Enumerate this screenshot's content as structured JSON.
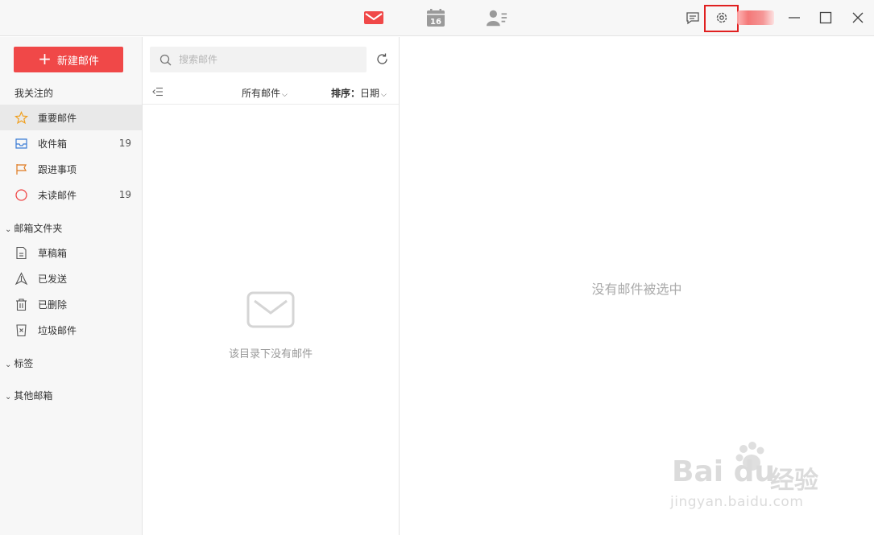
{
  "titlebar": {
    "tabs": [
      {
        "name": "mail",
        "icon": "mail-icon",
        "active": true
      },
      {
        "name": "calendar",
        "icon": "calendar-icon",
        "day": "16"
      },
      {
        "name": "contacts",
        "icon": "contacts-icon"
      }
    ],
    "actions": [
      "message-icon",
      "gear-icon"
    ],
    "window_controls": [
      "minimize-icon",
      "maximize-icon",
      "close-icon"
    ]
  },
  "sidebar": {
    "new_mail_label": "新建邮件",
    "favorites_title": "我关注的",
    "favorites": [
      {
        "label": "重要邮件",
        "icon": "star-icon",
        "count": ""
      },
      {
        "label": "收件箱",
        "icon": "inbox-icon",
        "count": "19"
      },
      {
        "label": "跟进事项",
        "icon": "flag-icon",
        "count": ""
      },
      {
        "label": "未读邮件",
        "icon": "unread-circle-icon",
        "count": "19"
      }
    ],
    "folders_title": "邮箱文件夹",
    "folders": [
      {
        "label": "草稿箱",
        "icon": "draft-icon"
      },
      {
        "label": "已发送",
        "icon": "sent-icon"
      },
      {
        "label": "已删除",
        "icon": "trash-icon"
      },
      {
        "label": "垃圾邮件",
        "icon": "spam-icon"
      }
    ],
    "tags_title": "标签",
    "other_title": "其他邮箱"
  },
  "list": {
    "search_placeholder": "搜索邮件",
    "filter_label": "所有邮件",
    "sort_prefix": "排序：",
    "sort_value": "日期",
    "empty_text": "该目录下没有邮件"
  },
  "reader": {
    "empty_text": "没有邮件被选中"
  },
  "colors": {
    "accent": "#f04848",
    "highlight_box": "#e02020"
  },
  "watermark": {
    "logo_text": "Bai du",
    "brand_text": "经验",
    "url_text": "jingyan.baidu.com"
  }
}
